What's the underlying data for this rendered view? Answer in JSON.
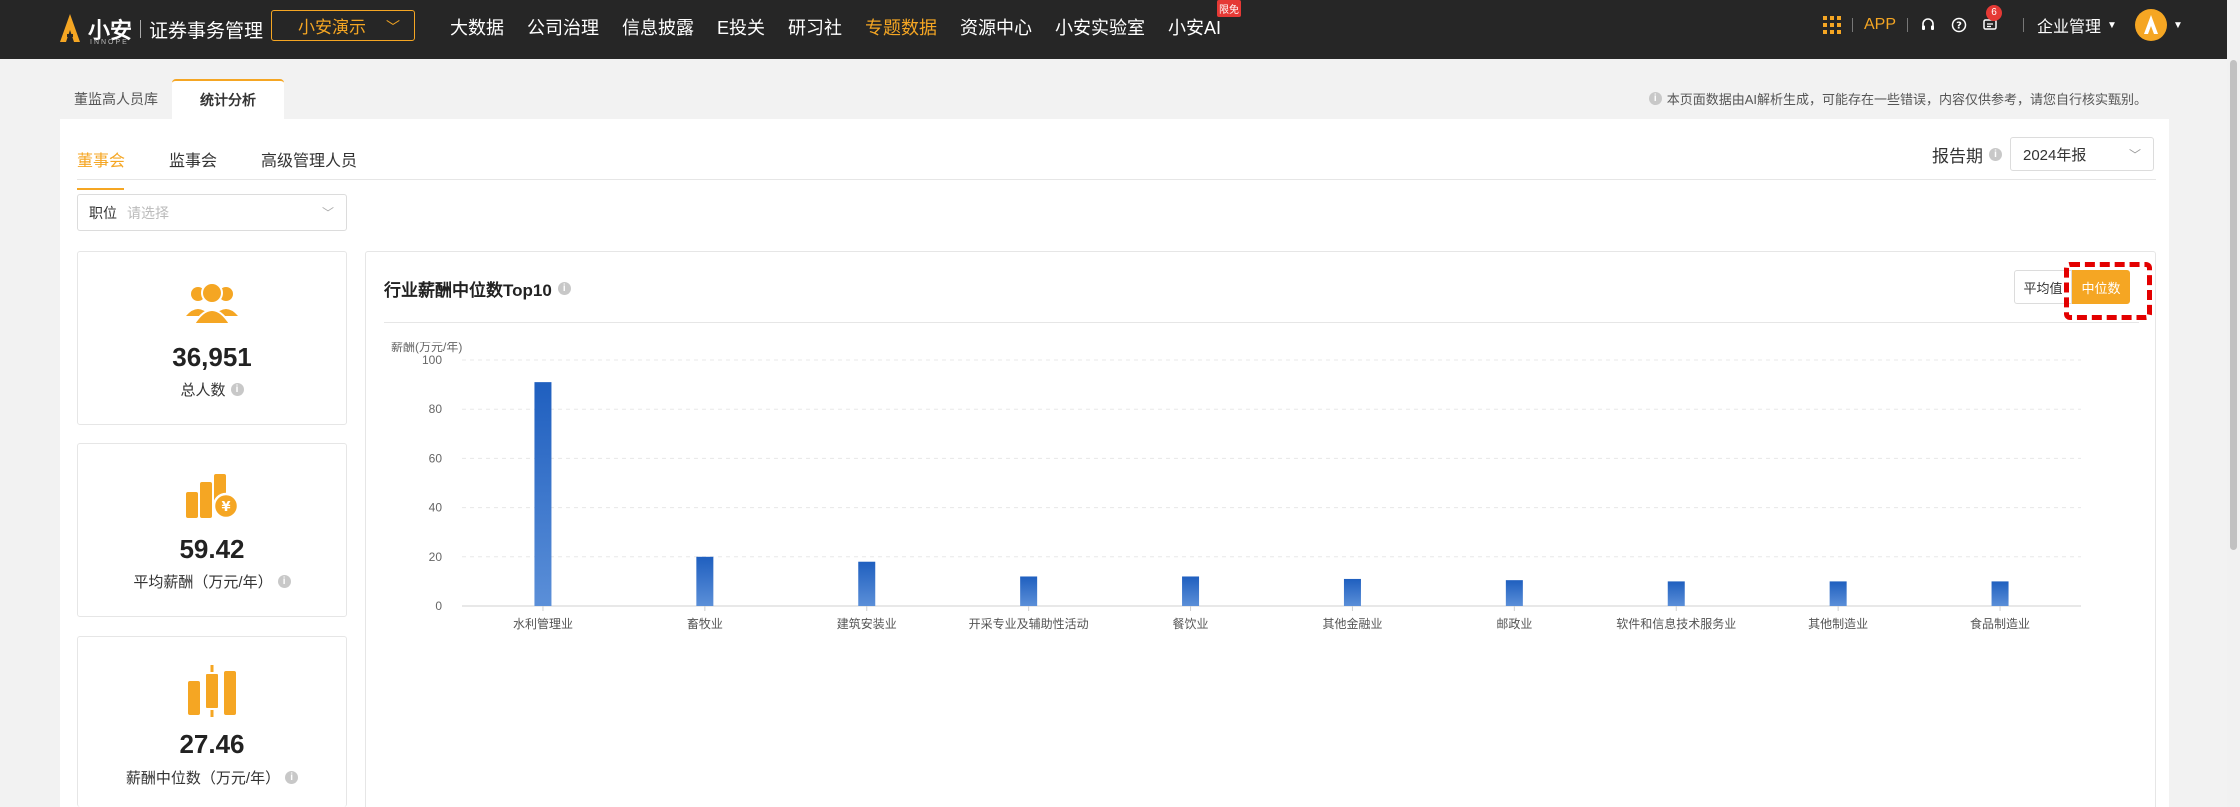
{
  "brand": {
    "name": "小安",
    "subtitle": "证券事务管理",
    "tagline": "INNOPE"
  },
  "demo_select": {
    "value": "小安演示"
  },
  "nav": {
    "items": [
      {
        "label": "大数据",
        "active": false
      },
      {
        "label": "公司治理",
        "active": false
      },
      {
        "label": "信息披露",
        "active": false
      },
      {
        "label": "E投关",
        "active": false
      },
      {
        "label": "研习社",
        "active": false
      },
      {
        "label": "专题数据",
        "active": true
      },
      {
        "label": "资源中心",
        "active": false
      },
      {
        "label": "小安实验室",
        "active": false
      },
      {
        "label": "小安AI",
        "active": false,
        "badge": "限免"
      }
    ]
  },
  "top_right": {
    "app_label": "APP",
    "message_count": "6",
    "corp_label": "企业管理"
  },
  "page_tabs": [
    {
      "label": "董监高人员库"
    },
    {
      "label": "统计分析"
    }
  ],
  "notice": "本页面数据由AI解析生成，可能存在一些错误，内容仅供参考，请您自行核实甄别。",
  "sub_tabs": [
    {
      "label": "董事会",
      "active": true
    },
    {
      "label": "监事会"
    },
    {
      "label": "高级管理人员"
    }
  ],
  "period": {
    "label": "报告期",
    "value": "2024年报"
  },
  "filter": {
    "label": "职位",
    "placeholder": "请选择"
  },
  "stats": [
    {
      "value": "36,951",
      "label": "总人数",
      "icon": "people-icon"
    },
    {
      "value": "59.42",
      "label": "平均薪酬（万元/年）",
      "icon": "coins-icon"
    },
    {
      "value": "27.46",
      "label": "薪酬中位数（万元/年）",
      "icon": "candlestick-icon"
    }
  ],
  "chart_panel": {
    "title": "行业薪酬中位数Top10",
    "toggle": {
      "avg_label": "平均值",
      "median_label": "中位数",
      "selected": "中位数"
    }
  },
  "colors": {
    "accent": "#f5a623",
    "bar_top": "#1f5fbf",
    "bar_bottom": "#5b8fd8",
    "topbar": "#262626"
  },
  "chart_data": {
    "type": "bar",
    "ylabel": "薪酬(万元/年)",
    "ylim": [
      0,
      100
    ],
    "yticks": [
      0,
      20,
      40,
      60,
      80,
      100
    ],
    "grid": true,
    "categories": [
      "水利管理业",
      "畜牧业",
      "建筑安装业",
      "开采专业及辅助性活动",
      "餐饮业",
      "其他金融业",
      "邮政业",
      "软件和信息技术服务业",
      "其他制造业",
      "食品制造业"
    ],
    "values": [
      91,
      20,
      18,
      12,
      12,
      11,
      10.5,
      10,
      10,
      10
    ]
  }
}
